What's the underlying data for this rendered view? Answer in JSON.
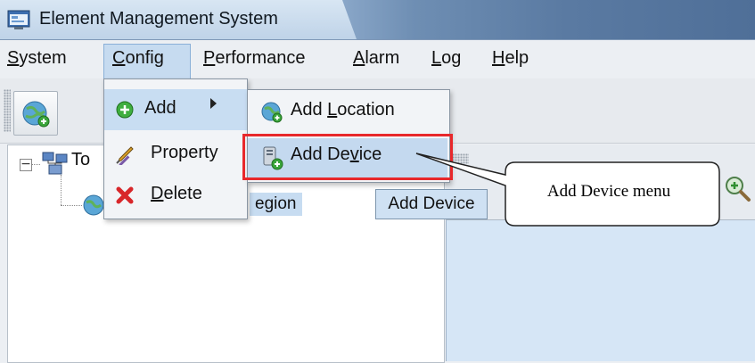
{
  "window": {
    "title": "Element Management System"
  },
  "menubar": {
    "items": [
      {
        "pre": "",
        "mn": "S",
        "post": "ystem"
      },
      {
        "pre": "",
        "mn": "C",
        "post": "onfig"
      },
      {
        "pre": "",
        "mn": "P",
        "post": "erformance"
      },
      {
        "pre": "",
        "mn": "A",
        "post": "larm"
      },
      {
        "pre": "",
        "mn": "L",
        "post": "og"
      },
      {
        "pre": "",
        "mn": "H",
        "post": "elp"
      }
    ]
  },
  "config_menu": {
    "add": "Add",
    "property": "Property",
    "delete_mn": "D",
    "delete_rest": "elete"
  },
  "add_submenu": {
    "location_pre": "Add ",
    "location_mn": "L",
    "location_post": "ocation",
    "device_pre": "Add De",
    "device_mn": "v",
    "device_post": "ice"
  },
  "tree": {
    "root_label": "To",
    "child_label": "egion"
  },
  "tooltip": "Add Device",
  "callout": "Add Device menu",
  "colors": {
    "highlight_border": "#e8282b",
    "selection": "#c8ddf2"
  },
  "icons": [
    "app-window-icon",
    "globe-add-icon",
    "plus-circle-icon",
    "pencil-icon",
    "delete-x-icon",
    "globe-add-icon",
    "device-add-icon",
    "network-tree-icon",
    "search-zoom-icon"
  ]
}
